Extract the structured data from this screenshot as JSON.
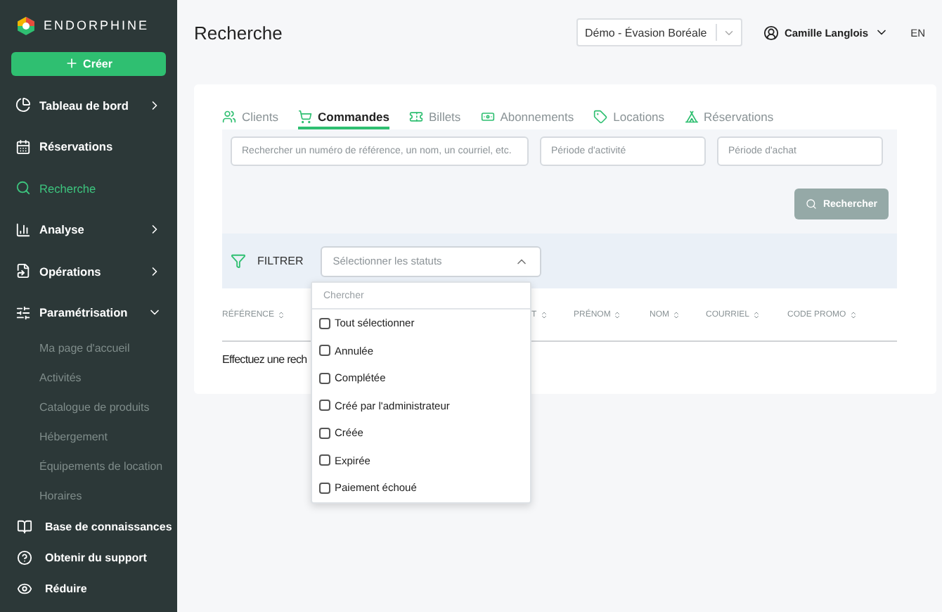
{
  "brand": {
    "name": "ENDORPHINE"
  },
  "create_button": {
    "label": "Créer"
  },
  "sidebar": {
    "items": [
      {
        "label": "Tableau de bord",
        "selected": false,
        "expanded": false
      },
      {
        "label": "Réservations",
        "selected": false
      },
      {
        "label": "Recherche",
        "selected": true
      },
      {
        "label": "Analyse",
        "selected": false,
        "expanded": false
      },
      {
        "label": "Opérations",
        "selected": false,
        "expanded": false
      },
      {
        "label": "Paramétrisation",
        "selected": false,
        "expanded": true,
        "children": [
          {
            "label": "Ma page d'accueil"
          },
          {
            "label": "Activités"
          },
          {
            "label": "Catalogue de produits"
          },
          {
            "label": "Hébergement"
          },
          {
            "label": "Équipements de location"
          },
          {
            "label": "Horaires"
          }
        ]
      }
    ],
    "footer": [
      {
        "label": "Base de connaissances"
      },
      {
        "label": "Obtenir du support"
      },
      {
        "label": "Réduire"
      }
    ]
  },
  "header": {
    "title": "Recherche",
    "organization": "Démo - Évasion Boréale",
    "user": "Camille Langlois",
    "language": "EN"
  },
  "tabs": [
    {
      "label": "Clients",
      "selected": false
    },
    {
      "label": "Commandes",
      "selected": true
    },
    {
      "label": "Billets",
      "selected": false
    },
    {
      "label": "Abonnements",
      "selected": false
    },
    {
      "label": "Locations",
      "selected": false
    },
    {
      "label": "Réservations",
      "selected": false
    }
  ],
  "search": {
    "query_placeholder": "Rechercher un numéro de référence, un nom, un courriel, etc.",
    "activity_placeholder": "Période d'activité",
    "purchase_placeholder": "Période d'achat",
    "button": "Rechercher"
  },
  "filter": {
    "label": "FILTRER",
    "placeholder": "Sélectionner les statuts",
    "expanded": true,
    "search_placeholder": "Chercher",
    "options": [
      {
        "label": "Tout sélectionner",
        "checked": false
      },
      {
        "label": "Annulée",
        "checked": false
      },
      {
        "label": "Complétée",
        "checked": false
      },
      {
        "label": "Créé par l'administrateur",
        "checked": false
      },
      {
        "label": "Créée",
        "checked": false
      },
      {
        "label": "Expirée",
        "checked": false
      },
      {
        "label": "Paiement échoué",
        "checked": false
      }
    ]
  },
  "table": {
    "columns": [
      {
        "label": "RÉFÉRENCE"
      },
      {
        "label": "T"
      },
      {
        "label": "PRÉNOM"
      },
      {
        "label": "NOM"
      },
      {
        "label": "COURRIEL"
      },
      {
        "label": "CODE PROMO"
      }
    ],
    "empty_message": "Effectuez une rech"
  }
}
